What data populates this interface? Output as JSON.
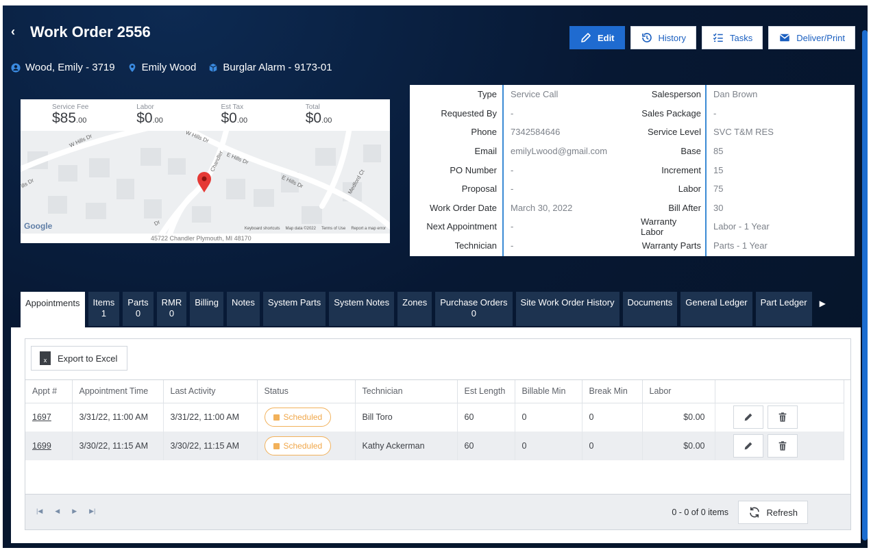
{
  "header": {
    "back_glyph": "‹",
    "title": "Work Order 2556",
    "buttons": {
      "edit": "Edit",
      "history": "History",
      "tasks": "Tasks",
      "deliver": "Deliver/Print"
    },
    "customer": "Wood, Emily - 3719",
    "location": "Emily Wood",
    "system": "Burglar Alarm - 9173-01"
  },
  "fees": [
    {
      "label": "Service Fee",
      "amount": "$85",
      "cents": ".00"
    },
    {
      "label": "Labor",
      "amount": "$0",
      "cents": ".00"
    },
    {
      "label": "Est Tax",
      "amount": "$0",
      "cents": ".00"
    },
    {
      "label": "Total",
      "amount": "$0",
      "cents": ".00"
    }
  ],
  "map": {
    "address": "45722 Chandler Plymouth, MI 48170",
    "provider": "Google",
    "attribution": [
      "Keyboard shortcuts",
      "Map data ©2022",
      "Terms of Use",
      "Report a map error"
    ],
    "streets": [
      "W Hills Dr",
      "W Hills Dr",
      "E Hills Dr",
      "E Hills Dr",
      "Medford Ct",
      "ills Dr",
      "Chandler",
      "Dr"
    ]
  },
  "details_left": [
    {
      "label": "Type",
      "value": "Service Call"
    },
    {
      "label": "Requested By",
      "value": "-"
    },
    {
      "label": "Phone",
      "value": "7342584646"
    },
    {
      "label": "Email",
      "value": "emilyLwood@gmail.com"
    },
    {
      "label": "PO Number",
      "value": "-"
    },
    {
      "label": "Proposal",
      "value": "-"
    },
    {
      "label": "Work Order Date",
      "value": "March 30, 2022"
    },
    {
      "label": "Next Appointment",
      "value": "-"
    },
    {
      "label": "Technician",
      "value": "-"
    }
  ],
  "details_right": [
    {
      "label": "Salesperson",
      "value": "Dan Brown"
    },
    {
      "label": "Sales Package",
      "value": "-"
    },
    {
      "label": "Service Level",
      "value": "SVC T&M RES"
    },
    {
      "label": "Base",
      "value": "85"
    },
    {
      "label": "Increment",
      "value": "15"
    },
    {
      "label": "Labor",
      "value": "75"
    },
    {
      "label": "Bill After",
      "value": "30"
    },
    {
      "label": "Warranty Labor",
      "value": "Labor - 1 Year"
    },
    {
      "label": "Warranty Parts",
      "value": "Parts - 1 Year"
    }
  ],
  "tabs": [
    {
      "label": "Appointments",
      "count": ""
    },
    {
      "label": "Items",
      "count": "1"
    },
    {
      "label": "Parts",
      "count": "0"
    },
    {
      "label": "RMR",
      "count": "0"
    },
    {
      "label": "Billing",
      "count": ""
    },
    {
      "label": "Notes",
      "count": ""
    },
    {
      "label": "System Parts",
      "count": ""
    },
    {
      "label": "System Notes",
      "count": ""
    },
    {
      "label": "Zones",
      "count": ""
    },
    {
      "label": "Purchase Orders",
      "count": "0"
    },
    {
      "label": "Site Work Order History",
      "count": ""
    },
    {
      "label": "Documents",
      "count": ""
    },
    {
      "label": "General Ledger",
      "count": ""
    },
    {
      "label": "Part Ledger",
      "count": ""
    }
  ],
  "tab_next_glyph": "▶",
  "grid": {
    "export_label": "Export to Excel",
    "excel_glyph": "x",
    "columns": [
      "Appt #",
      "Appointment Time",
      "Last Activity",
      "Status",
      "Technician",
      "Est Length",
      "Billable Min",
      "Break Min",
      "Labor",
      ""
    ],
    "rows": [
      {
        "appt": "1697",
        "time": "3/31/22, 11:00 AM",
        "last": "3/31/22, 11:00 AM",
        "status": "Scheduled",
        "tech": "Bill Toro",
        "est": "60",
        "billable": "0",
        "break": "0",
        "labor": "$0.00"
      },
      {
        "appt": "1699",
        "time": "3/30/22, 11:15 AM",
        "last": "3/30/22, 11:15 AM",
        "status": "Scheduled",
        "tech": "Kathy Ackerman",
        "est": "60",
        "billable": "0",
        "break": "0",
        "labor": "$0.00"
      }
    ],
    "pager_glyphs": [
      "|◀",
      "◀",
      "▶",
      "▶|"
    ],
    "pager_count": "0 - 0 of 0 items",
    "refresh_label": "Refresh"
  }
}
